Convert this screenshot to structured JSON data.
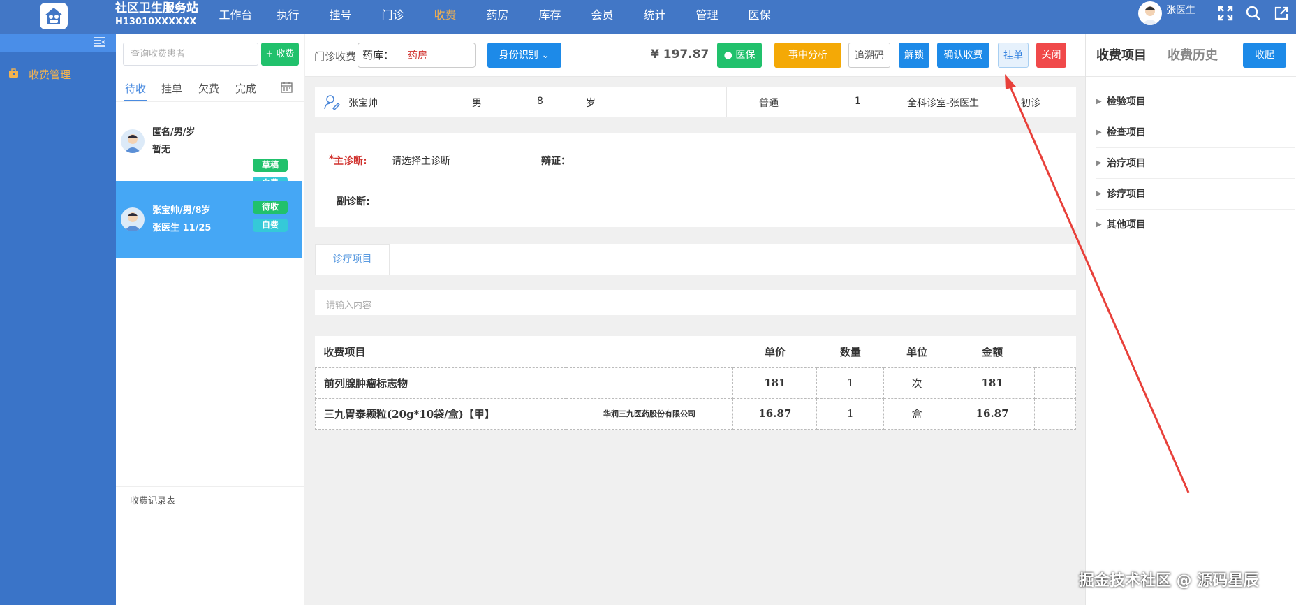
{
  "header": {
    "site_name": "社区卫生服务站",
    "site_code": "H13010XXXXXX",
    "nav": [
      "工作台",
      "执行",
      "挂号",
      "门诊",
      "收费",
      "药房",
      "库存",
      "会员",
      "统计",
      "管理",
      "医保"
    ],
    "active_nav": "收费",
    "user_name": "张医生"
  },
  "sidebar": {
    "item": "收费管理"
  },
  "patient_list": {
    "search_placeholder": "查询收费患者",
    "add_button": "+ 收费",
    "tabs": [
      "待收",
      "挂单",
      "欠费",
      "完成"
    ],
    "rows": [
      {
        "line1": "匿名/男/岁",
        "line2": "暂无",
        "badge1": "草稿",
        "badge2": "自费"
      },
      {
        "line1": "张宝帅/男/8岁",
        "line2": "张医生   11/25",
        "badge1": "待收",
        "badge2": "自费"
      }
    ],
    "records_label": "收费记录表"
  },
  "toolbar": {
    "mode_label": "门诊收费",
    "pharmacy_label": "药库：",
    "pharmacy_value": "药房",
    "identify_button": "身份识别",
    "total": "¥ 197.87",
    "insurance_button": "医保",
    "analysis_button": "事中分析",
    "trace_button": "追溯码",
    "unlock_button": "解锁",
    "confirm_button": "确认收费",
    "hold_button": "挂单",
    "close_button": "关闭"
  },
  "patient_info": {
    "name": "张宝帅",
    "sex": "男",
    "age": "8",
    "age_unit": "岁",
    "visit_type": "普通",
    "count": "1",
    "department": "全科诊室-张医生",
    "visit": "初诊"
  },
  "diagnosis": {
    "main_label": "主诊断:",
    "main_required": "*",
    "main_value": "请选择主诊断",
    "syndrome_label": "辩证：",
    "secondary_label": "副诊断:"
  },
  "items_section": {
    "tab": "诊疗项目",
    "filter_placeholder": "请输入内容",
    "columns": [
      "收费项目",
      "单价",
      "数量",
      "单位",
      "金额"
    ],
    "rows": [
      {
        "name": "前列腺肿瘤标志物",
        "vendor": "",
        "price": "181",
        "qty": "1",
        "unit": "次",
        "amount": "181"
      },
      {
        "name": "三九胃泰颗粒(20g*10袋/盒)【甲】",
        "vendor": "华润三九医药股份有限公司",
        "price": "16.87",
        "qty": "1",
        "unit": "盒",
        "amount": "16.87"
      }
    ]
  },
  "right_panel": {
    "tab1": "收费项目",
    "tab2": "收费历史",
    "collapse_button": "收起",
    "categories": [
      "检验项目",
      "检查项目",
      "治疗项目",
      "诊疗项目",
      "其他项目"
    ]
  },
  "watermark": "掘金技术社区 @ 源码星辰",
  "colors": {
    "topbar": "#4277c6",
    "accent": "#1d8ae8",
    "green": "#21c16c",
    "orange": "#f4a906",
    "red": "#f0494a",
    "arrow": "#e8403a"
  }
}
